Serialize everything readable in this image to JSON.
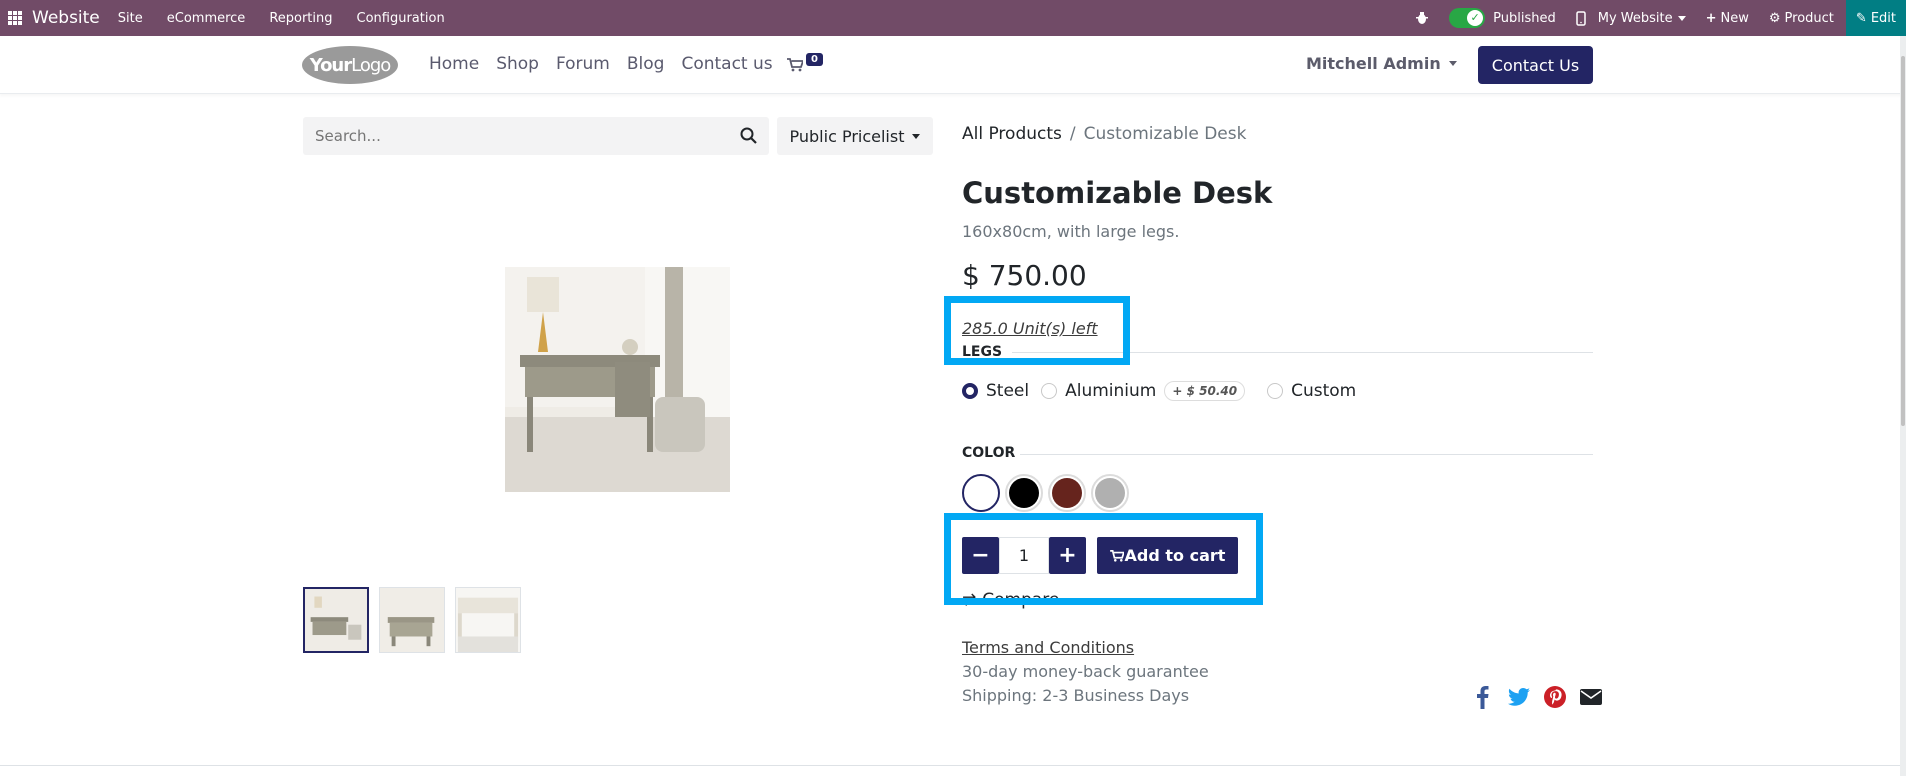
{
  "adminbar": {
    "brand": "Website",
    "menus": [
      "Site",
      "eCommerce",
      "Reporting",
      "Configuration"
    ],
    "published_label": "Published",
    "website_label": "My Website",
    "new_label": "New",
    "product_label": "Product",
    "edit_label": "Edit",
    "color": "#714B67"
  },
  "header": {
    "logo_text_bold": "Your",
    "logo_text_light": "Logo",
    "nav": [
      "Home",
      "Shop",
      "Forum",
      "Blog",
      "Contact us"
    ],
    "cart_count": "0",
    "user_name": "Mitchell Admin",
    "contact_button": "Contact Us",
    "accent": "#232564"
  },
  "shop": {
    "search_placeholder": "Search...",
    "pricelist": "Public Pricelist"
  },
  "product": {
    "breadcrumb_root": "All Products",
    "breadcrumb_sep": "/",
    "breadcrumb_current": "Customizable Desk",
    "name": "Customizable Desk",
    "description": "160x80cm, with large legs.",
    "price": "$ 750.00",
    "stock": "285.0 Unit(s) left",
    "legs_title": "LEGS",
    "legs_options": [
      {
        "label": "Steel",
        "selected": true
      },
      {
        "label": "Aluminium",
        "extra": "+ $ 50.40",
        "selected": false
      },
      {
        "label": "Custom",
        "selected": false
      }
    ],
    "color_title": "COLOR",
    "color_options": [
      "#ffffff",
      "#000000",
      "#66241d",
      "#b0b0b0"
    ],
    "quantity": "1",
    "add_to_cart": "Add to cart",
    "compare": "Compare",
    "terms": "Terms and Conditions",
    "guarantee": "30-day money-back guarantee",
    "shipping": "Shipping: 2-3 Business Days"
  },
  "social_icons": [
    "facebook-icon",
    "twitter-icon",
    "pinterest-icon",
    "email-icon"
  ],
  "highlight_color": "#02a8f4"
}
